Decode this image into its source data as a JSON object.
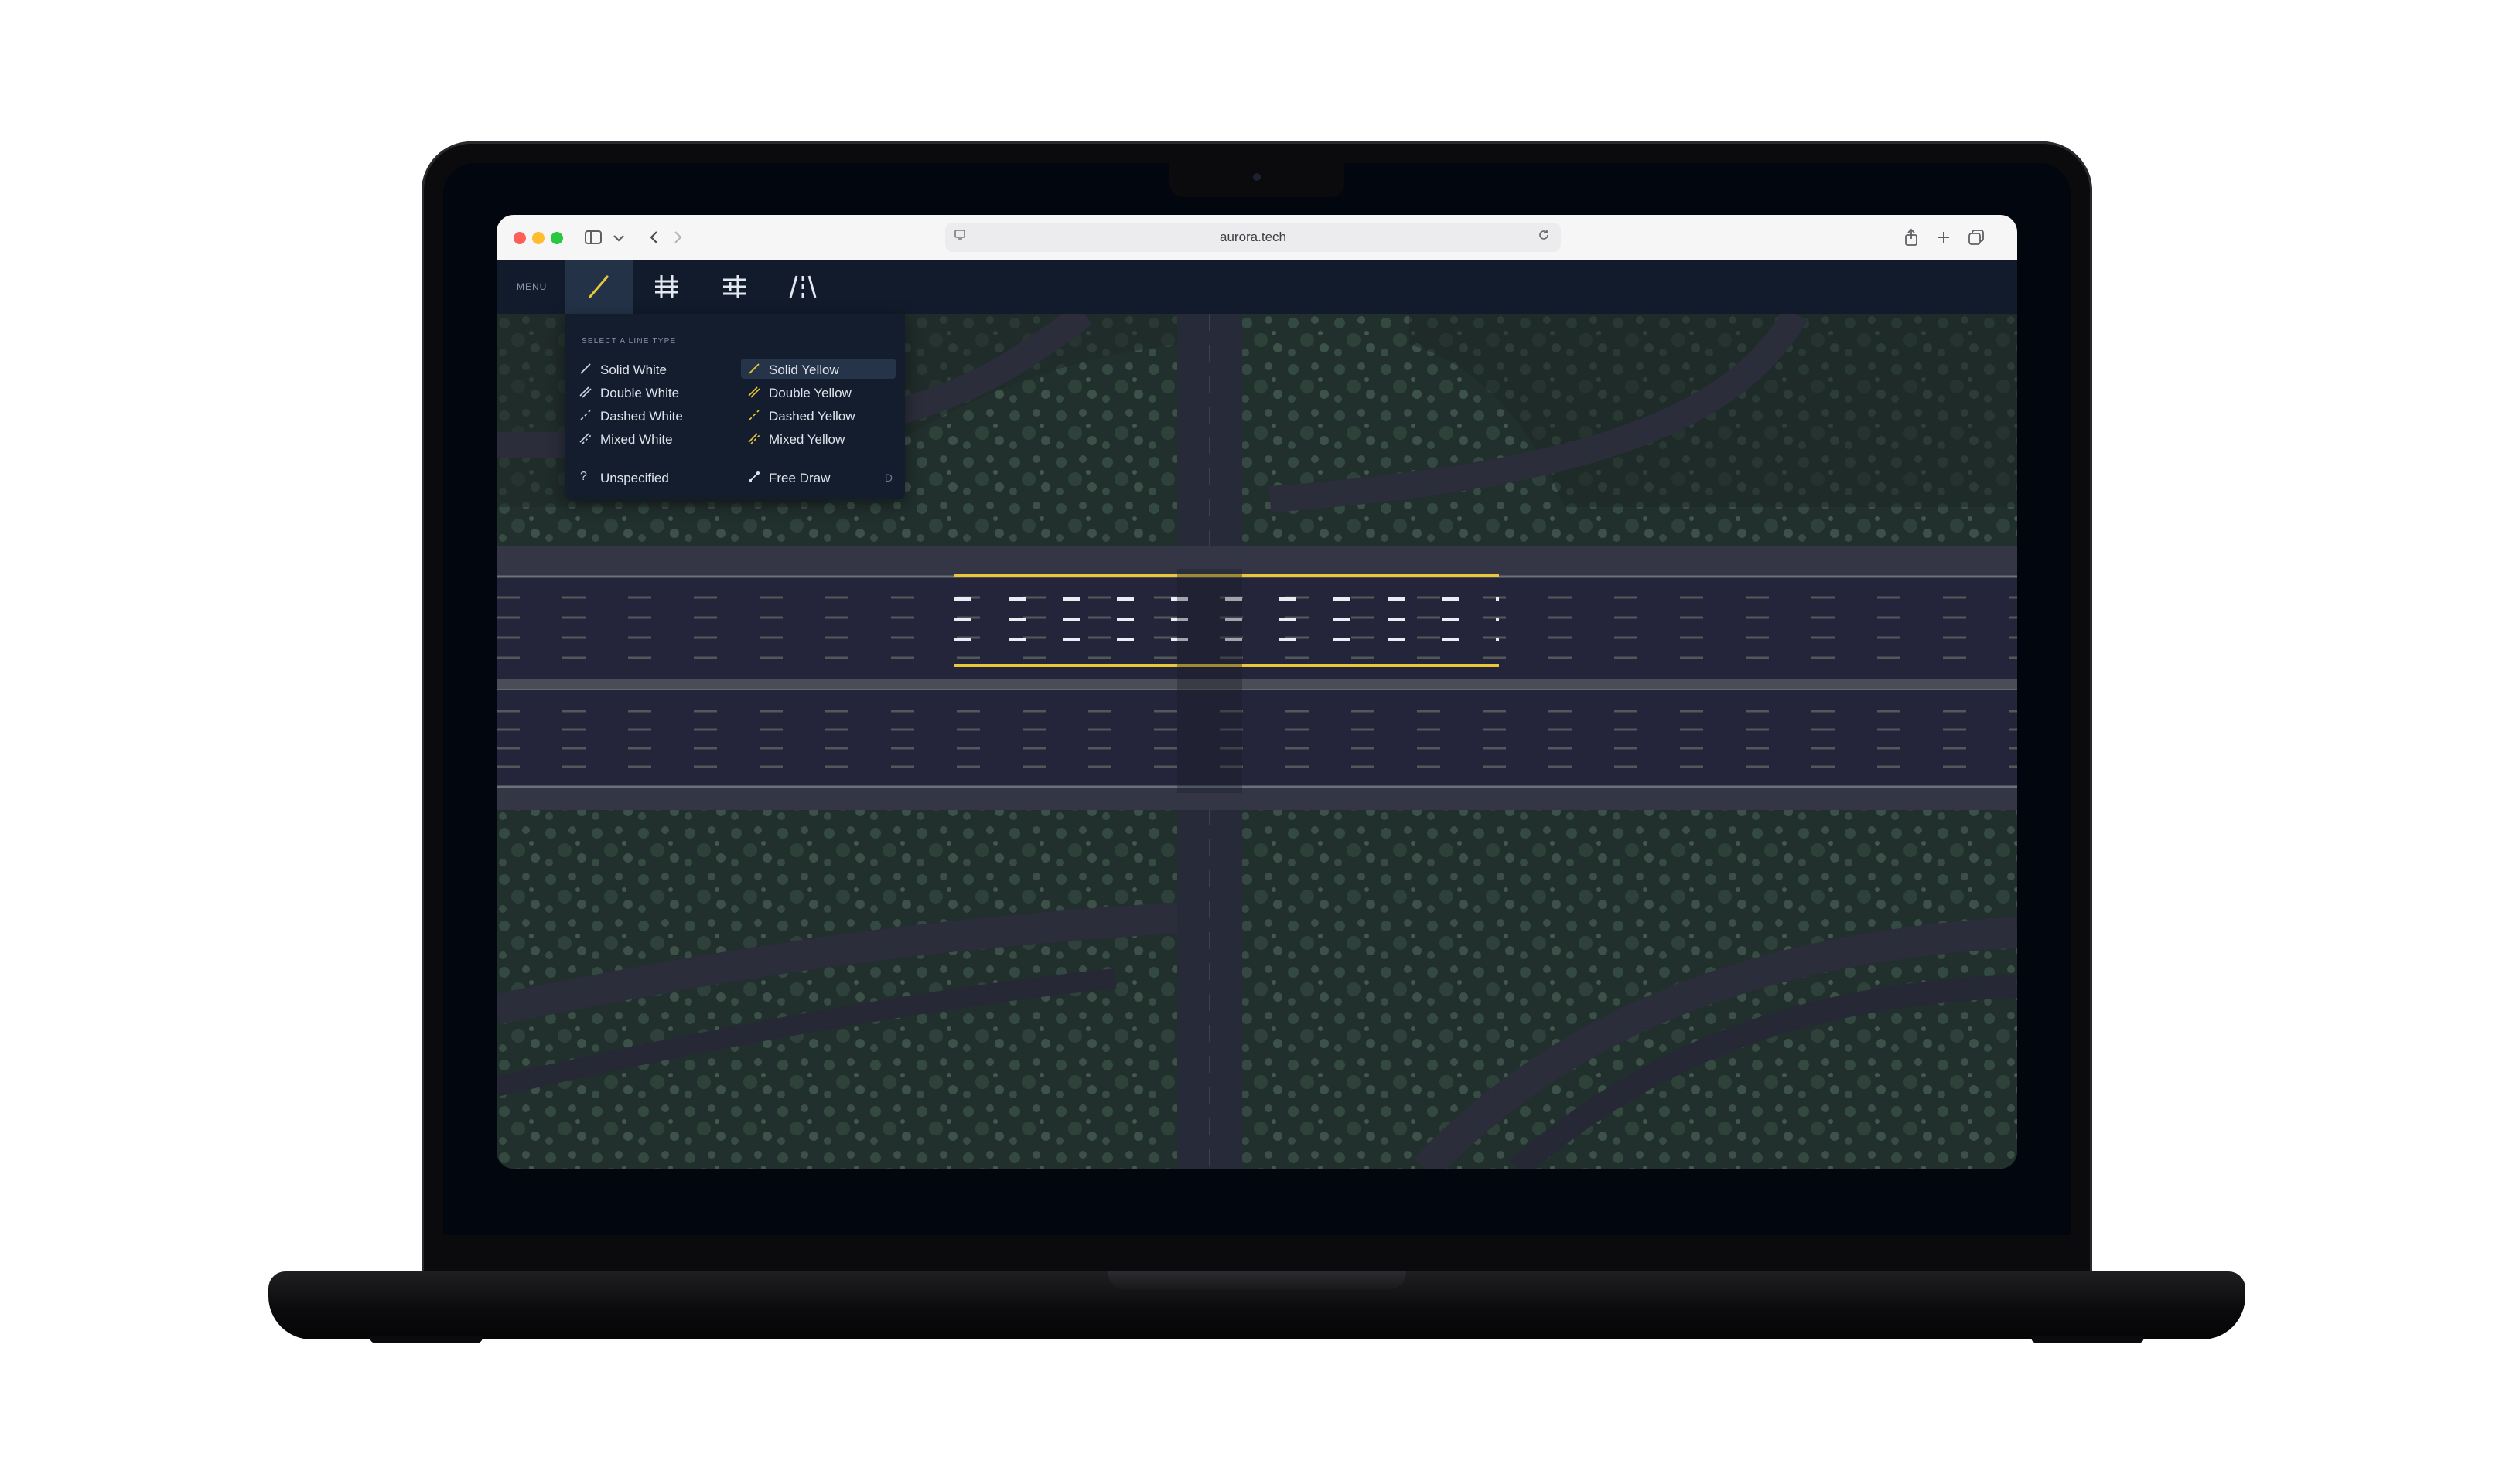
{
  "browser": {
    "url": "aurora.tech",
    "icons": {
      "sidebar": "sidebar-toggle-icon",
      "chevron": "chevron-down-icon",
      "back": "back-arrow-icon",
      "forward": "forward-arrow-icon",
      "share": "share-icon",
      "new_tab": "plus-icon",
      "tabs": "tab-overview-icon",
      "reload": "reload-icon"
    }
  },
  "app": {
    "menu_label": "MENU",
    "tools": [
      {
        "name": "line-tool",
        "icon": "line-icon",
        "active": true
      },
      {
        "name": "grid-tool",
        "icon": "hash-grid-icon",
        "active": false
      },
      {
        "name": "crosswalk-tool",
        "icon": "crossing-lines-icon",
        "active": false
      },
      {
        "name": "lane-tool",
        "icon": "lane-icon",
        "active": false
      }
    ],
    "dropdown": {
      "title": "SELECT A LINE TYPE",
      "left_column": [
        {
          "label": "Solid White",
          "icon": "solid-line-icon"
        },
        {
          "label": "Double White",
          "icon": "double-line-icon"
        },
        {
          "label": "Dashed White",
          "icon": "dashed-line-icon"
        },
        {
          "label": "Mixed White",
          "icon": "mixed-line-icon"
        }
      ],
      "right_column": [
        {
          "label": "Solid Yellow",
          "icon": "solid-line-icon",
          "selected": true
        },
        {
          "label": "Double Yellow",
          "icon": "double-line-icon"
        },
        {
          "label": "Dashed Yellow",
          "icon": "dashed-line-icon"
        },
        {
          "label": "Mixed Yellow",
          "icon": "mixed-line-icon"
        }
      ],
      "unspecified": {
        "label": "Unspecified",
        "icon_char": "?"
      },
      "free_draw": {
        "label": "Free Draw",
        "shortcut": "D",
        "icon": "free-draw-icon"
      }
    }
  },
  "colors": {
    "white_line": "#e9edf3",
    "yellow_line": "#e9c63a",
    "toolbar": "#121b2b",
    "dropdown": "#131d2e",
    "selected": "#26344a"
  }
}
